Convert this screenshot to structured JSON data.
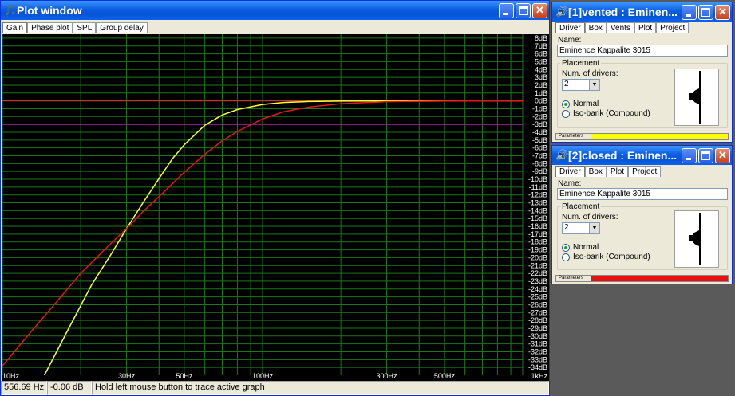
{
  "plot_window": {
    "title": "Plot window",
    "tabs": [
      "Gain",
      "Phase plot",
      "SPL",
      "Group delay"
    ],
    "status": {
      "frequency": "556.69 Hz",
      "level": "-0.06 dB",
      "hint": "Hold left mouse button to trace active graph"
    }
  },
  "chart_data": {
    "type": "line",
    "xscale": "log",
    "xlim": [
      10,
      1000
    ],
    "ylim": [
      -35,
      8.5
    ],
    "x_tick_labels": [
      {
        "value": 10,
        "label": "10Hz"
      },
      {
        "value": 30,
        "label": "30Hz"
      },
      {
        "value": 50,
        "label": "50Hz"
      },
      {
        "value": 100,
        "label": "100Hz"
      },
      {
        "value": 300,
        "label": "300Hz"
      },
      {
        "value": 500,
        "label": "500Hz"
      },
      {
        "value": 1000,
        "label": "1kHz"
      }
    ],
    "y_tick_labels": [
      "8dB",
      "7dB",
      "6dB",
      "5dB",
      "4dB",
      "3dB",
      "2dB",
      "1dB",
      "0dB",
      "-1dB",
      "-2dB",
      "-3dB",
      "-4dB",
      "-5dB",
      "-6dB",
      "-7dB",
      "-8dB",
      "-9dB",
      "-10dB",
      "-11dB",
      "-12dB",
      "-13dB",
      "-14dB",
      "-15dB",
      "-16dB",
      "-17dB",
      "-18dB",
      "-19dB",
      "-20dB",
      "-21dB",
      "-22dB",
      "-23dB",
      "-24dB",
      "-25dB",
      "-26dB",
      "-27dB",
      "-28dB",
      "-29dB",
      "-30dB",
      "-31dB",
      "-32dB",
      "-33dB",
      "-34dB"
    ],
    "reference_lines": [
      {
        "y": 0,
        "color": "#e03030"
      },
      {
        "y": -3,
        "color": "#c020c0"
      }
    ],
    "series": [
      {
        "color": "#ffff30",
        "x": [
          14.5,
          18,
          22,
          26,
          30,
          35,
          40,
          45,
          50,
          60,
          70,
          80,
          100,
          120,
          150,
          200,
          300,
          500,
          1000
        ],
        "y": [
          -35,
          -29,
          -23.5,
          -19.7,
          -16.3,
          -12.8,
          -9.9,
          -7.4,
          -5.6,
          -3.1,
          -1.8,
          -1.1,
          -0.45,
          -0.2,
          -0.08,
          -0.03,
          -0.01,
          0,
          0
        ]
      },
      {
        "color": "#e01818",
        "x": [
          10,
          13,
          16,
          20,
          25,
          30,
          35,
          40,
          50,
          60,
          70,
          80,
          100,
          120,
          150,
          200,
          300,
          500,
          1000
        ],
        "y": [
          -33.8,
          -29.3,
          -25.8,
          -22,
          -18.8,
          -16.3,
          -14,
          -12.2,
          -9.1,
          -6.8,
          -5.1,
          -3.9,
          -2.3,
          -1.4,
          -0.8,
          -0.35,
          -0.1,
          -0.03,
          0
        ]
      }
    ]
  },
  "box1": {
    "title": "[1]vented : Eminen...",
    "tabs": [
      "Driver",
      "Box",
      "Vents",
      "Plot",
      "Project"
    ],
    "name_label": "Name:",
    "name_value": "Eminence Kappalite 3015",
    "placement_label": "Placement",
    "num_drivers_label": "Num. of drivers:",
    "num_drivers_value": "2",
    "radio_normal": "Normal",
    "radio_iso": "Iso-barik (Compound)",
    "parameters_label": "Parameters",
    "color": "#ffff00"
  },
  "box2": {
    "title": "[2]closed : Eminen...",
    "tabs": [
      "Driver",
      "Box",
      "Plot",
      "Project"
    ],
    "name_label": "Name:",
    "name_value": "Eminence Kappalite 3015",
    "placement_label": "Placement",
    "num_drivers_label": "Num. of drivers:",
    "num_drivers_value": "2",
    "radio_normal": "Normal",
    "radio_iso": "Iso-barik (Compound)",
    "parameters_label": "Parameters",
    "color": "#e81010"
  }
}
